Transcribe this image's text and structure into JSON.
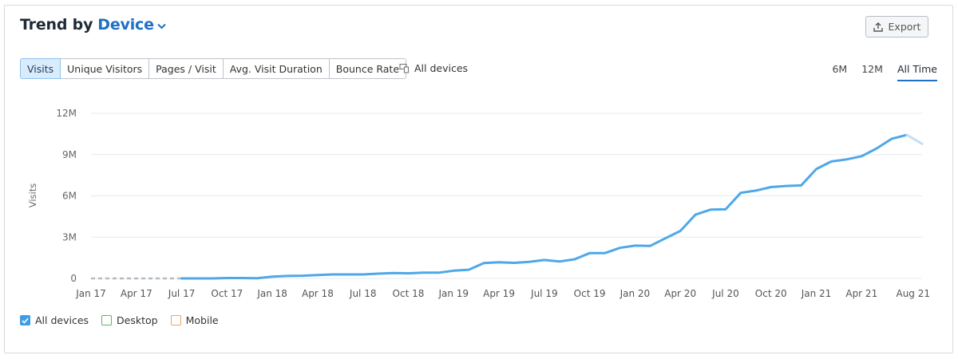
{
  "header": {
    "title_prefix": "Trend by",
    "dimension_label": "Device",
    "export_label": "Export"
  },
  "metric_tabs": [
    {
      "label": "Visits",
      "active": true
    },
    {
      "label": "Unique Visitors",
      "active": false
    },
    {
      "label": "Pages / Visit",
      "active": false
    },
    {
      "label": "Avg. Visit Duration",
      "active": false
    },
    {
      "label": "Bounce Rate",
      "active": false
    }
  ],
  "device_filter": {
    "label": "All devices",
    "icon": "devices-icon"
  },
  "range_tabs": [
    {
      "label": "6M",
      "active": false
    },
    {
      "label": "12M",
      "active": false
    },
    {
      "label": "All Time",
      "active": true
    }
  ],
  "legend": [
    {
      "label": "All devices",
      "checked": true,
      "color": "#3c9ee6"
    },
    {
      "label": "Desktop",
      "checked": false,
      "color": "#5cb85c"
    },
    {
      "label": "Mobile",
      "checked": false,
      "color": "#f0a35e"
    }
  ],
  "colors": {
    "accent": "#1f6fc4",
    "line": "#4ea8e8",
    "line_faded": "#bfe0f7",
    "dashed": "#b5bcc4",
    "grid": "#e6e8eb"
  },
  "chart_data": {
    "type": "line",
    "title": "",
    "xlabel": "",
    "ylabel": "Visits",
    "ylim": [
      0,
      12000000
    ],
    "yticks": [
      {
        "value": 0,
        "label": "0"
      },
      {
        "value": 3000000,
        "label": "3M"
      },
      {
        "value": 6000000,
        "label": "6M"
      },
      {
        "value": 9000000,
        "label": "9M"
      },
      {
        "value": 12000000,
        "label": "12M"
      }
    ],
    "xticks": [
      "Jan 17",
      "Apr 17",
      "Jul 17",
      "Oct 17",
      "Jan 18",
      "Apr 18",
      "Jul 18",
      "Oct 18",
      "Jan 19",
      "Apr 19",
      "Jul 19",
      "Oct 19",
      "Jan 20",
      "Apr 20",
      "Jul 20",
      "Oct 20",
      "Jan 21",
      "Apr 21",
      "Aug 21"
    ],
    "grid": true,
    "series": [
      {
        "x": [
          "2017-01",
          "2017-02",
          "2017-03",
          "2017-04",
          "2017-05",
          "2017-06",
          "2017-07",
          "2017-08",
          "2017-09",
          "2017-10",
          "2017-11",
          "2017-12",
          "2018-01",
          "2018-02",
          "2018-03",
          "2018-04",
          "2018-05",
          "2018-06",
          "2018-07",
          "2018-08",
          "2018-09",
          "2018-10",
          "2018-11",
          "2018-12",
          "2019-01",
          "2019-02",
          "2019-03",
          "2019-04",
          "2019-05",
          "2019-06",
          "2019-07",
          "2019-08",
          "2019-09",
          "2019-10",
          "2019-11",
          "2019-12",
          "2020-01",
          "2020-02",
          "2020-03",
          "2020-04",
          "2020-05",
          "2020-06",
          "2020-07",
          "2020-08",
          "2020-09",
          "2020-10",
          "2020-11",
          "2020-12",
          "2021-01",
          "2021-02",
          "2021-03",
          "2021-04",
          "2021-05",
          "2021-06",
          "2021-07",
          "2021-08"
        ],
        "values": [
          0,
          0,
          0,
          0,
          0,
          0,
          0,
          0,
          0,
          30000,
          30000,
          20000,
          130000,
          180000,
          200000,
          250000,
          290000,
          290000,
          290000,
          350000,
          390000,
          370000,
          420000,
          420000,
          560000,
          630000,
          1120000,
          1170000,
          1130000,
          1200000,
          1340000,
          1230000,
          1390000,
          1840000,
          1840000,
          2220000,
          2380000,
          2360000,
          2910000,
          3450000,
          4630000,
          5000000,
          5020000,
          6220000,
          6380000,
          6640000,
          6720000,
          6760000,
          7950000,
          8500000,
          8650000,
          8880000,
          9450000,
          10150000,
          10430000,
          9780000
        ],
        "missing_before": "2017-07",
        "partial_month": "2021-08"
      }
    ]
  }
}
